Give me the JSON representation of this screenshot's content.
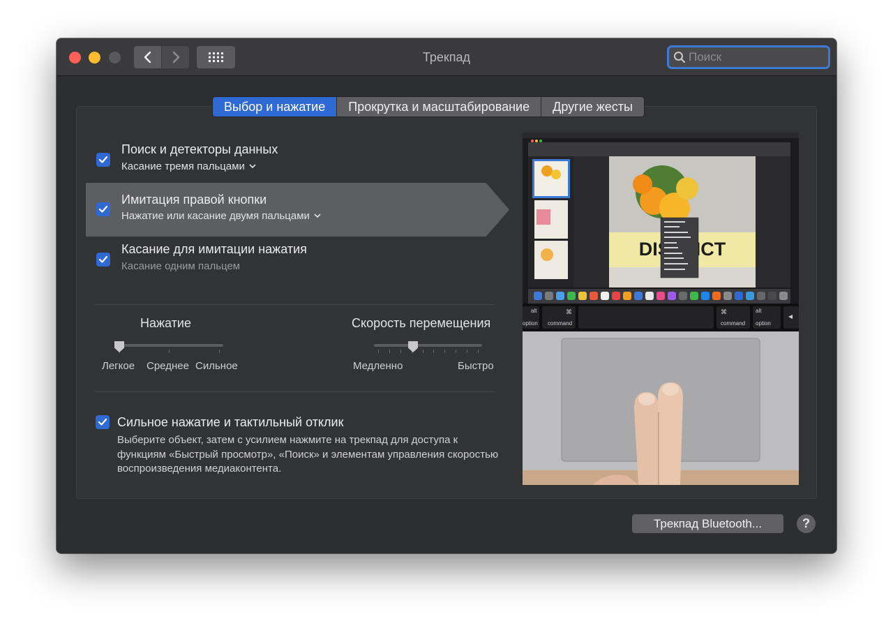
{
  "window": {
    "title": "Трекпад",
    "search_placeholder": "Поиск"
  },
  "tabs": [
    {
      "label": "Выбор и нажатие",
      "active": true
    },
    {
      "label": "Прокрутка и масштабирование",
      "active": false
    },
    {
      "label": "Другие жесты",
      "active": false
    }
  ],
  "options": [
    {
      "title": "Поиск и детекторы данных",
      "subtitle": "Касание тремя пальцами",
      "checked": true,
      "has_dropdown": true
    },
    {
      "title": "Имитация правой кнопки",
      "subtitle": "Нажатие или касание двумя пальцами",
      "checked": true,
      "has_dropdown": true
    },
    {
      "title": "Касание для имитации нажатия",
      "subtitle": "Касание одним пальцем",
      "checked": true,
      "has_dropdown": false
    }
  ],
  "click_slider": {
    "label": "Нажатие",
    "ticks": [
      "Легкое",
      "Среднее",
      "Сильное"
    ],
    "value": 0
  },
  "speed_slider": {
    "label": "Скорость перемещения",
    "min_label": "Медленно",
    "max_label": "Быстро",
    "value": 0.35
  },
  "force_click": {
    "title": "Сильное нажатие и тактильный отклик",
    "checked": true,
    "description": "Выберите объект, затем с усилием нажмите на трекпад для доступа к функциям «Быстрый просмотр», «Поиск» и элементам управления скоростью воспроизведения медиаконтента."
  },
  "preview": {
    "magazine_title": "DISTRICT",
    "keys": {
      "alt": "alt",
      "option": "option",
      "cmd_symbol": "⌘",
      "command": "command"
    }
  },
  "footer": {
    "bluetooth_button": "Трекпад Bluetooth...",
    "help_button": "?"
  },
  "colors": {
    "accent": "#2f6ad4",
    "window_bg": "#2d2e30"
  }
}
